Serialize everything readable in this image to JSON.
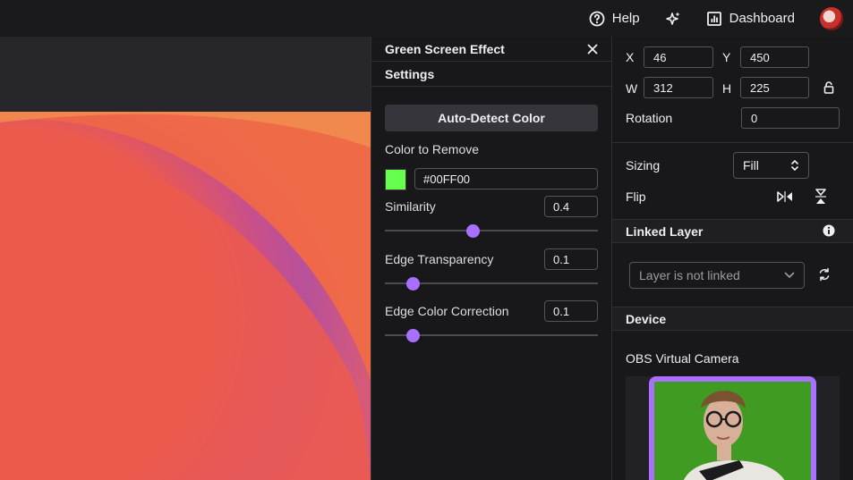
{
  "topbar": {
    "help_label": "Help",
    "dashboard_label": "Dashboard"
  },
  "green_screen": {
    "title": "Green Screen Effect",
    "settings_label": "Settings",
    "auto_detect_label": "Auto-Detect Color",
    "color_to_remove_label": "Color to Remove",
    "color_value": "#00FF00",
    "swatch_color": "#66ff4d",
    "similarity": {
      "label": "Similarity",
      "value": "0.4",
      "fraction": 0.41
    },
    "edge_transparency": {
      "label": "Edge Transparency",
      "value": "0.1",
      "fraction": 0.13
    },
    "edge_color_correction": {
      "label": "Edge Color Correction",
      "value": "0.1",
      "fraction": 0.13
    }
  },
  "transform": {
    "x_label": "X",
    "x_value": "46",
    "y_label": "Y",
    "y_value": "450",
    "w_label": "W",
    "w_value": "312",
    "h_label": "H",
    "h_value": "225",
    "rotation_label": "Rotation",
    "rotation_value": "0",
    "sizing_label": "Sizing",
    "sizing_value": "Fill",
    "flip_label": "Flip"
  },
  "linked_layer": {
    "title": "Linked Layer",
    "select_value": "Layer is not linked"
  },
  "device": {
    "title": "Device",
    "camera_name": "OBS Virtual Camera"
  },
  "colors": {
    "accent": "#a970ff",
    "panel_bg": "#18181b"
  }
}
